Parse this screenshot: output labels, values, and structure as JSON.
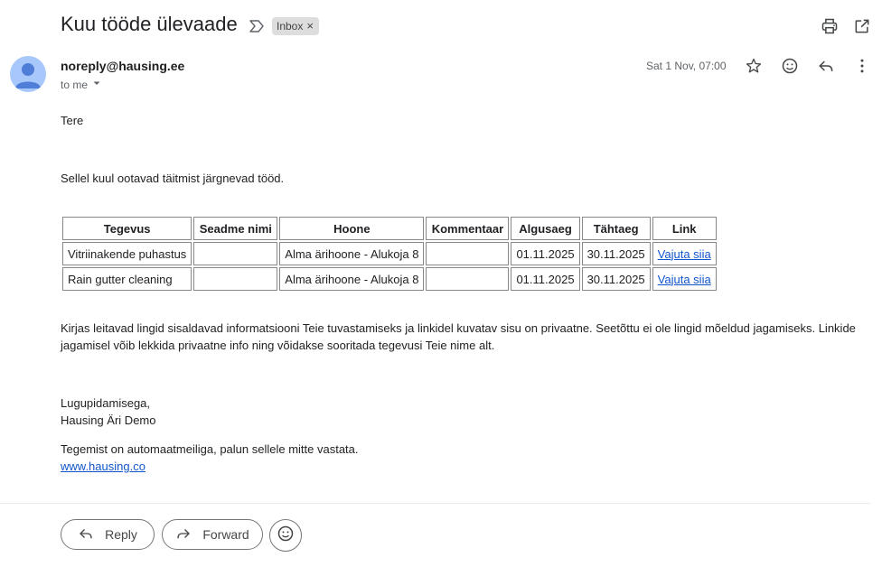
{
  "subject": "Kuu tööde ülevaade",
  "label": {
    "name": "Inbox",
    "remove": "×"
  },
  "sender": {
    "email": "noreply@hausing.ee",
    "to": "to me"
  },
  "date": "Sat 1 Nov, 07:00",
  "icons": {
    "print": "printer-icon",
    "popout": "open-in-new-window-icon",
    "importance": "importance-marker-icon",
    "star": "star-icon",
    "emoji": "emoji-icon",
    "reply": "reply-icon",
    "more": "more-vert-icon",
    "avatar": "avatar-icon",
    "forward": "forward-icon",
    "dropdown": "chevron-down-icon"
  },
  "body": {
    "greeting": "Tere",
    "intro": "Sellel kuul ootavad täitmist järgnevad tööd.",
    "table": {
      "headers": [
        "Tegevus",
        "Seadme nimi",
        "Hoone",
        "Kommentaar",
        "Algusaeg",
        "Tähtaeg",
        "Link"
      ],
      "rows": [
        [
          "Vitriinakende puhastus",
          "",
          "Alma ärihoone - Alukoja 8",
          "",
          "01.11.2025",
          "30.11.2025",
          "Vajuta siia"
        ],
        [
          "Rain gutter cleaning",
          "",
          "Alma ärihoone - Alukoja 8",
          "",
          "01.11.2025",
          "30.11.2025",
          "Vajuta siia"
        ]
      ]
    },
    "notice": "Kirjas leitavad lingid sisaldavad informatsiooni Teie tuvastamiseks ja linkidel kuvatav sisu on privaatne. Seetõttu ei ole lingid mõeldud jagamiseks. Linkide jagamisel võib lekkida privaatne info ning võidakse sooritada tegevusi Teie nime alt.",
    "closing": "Lugupidamisega,",
    "signature": "Hausing Äri Demo",
    "autonote": "Tegemist on automaatmeiliga, palun sellele mitte vastata.",
    "website": "www.hausing.co"
  },
  "actions": {
    "reply": "Reply",
    "forward": "Forward"
  }
}
